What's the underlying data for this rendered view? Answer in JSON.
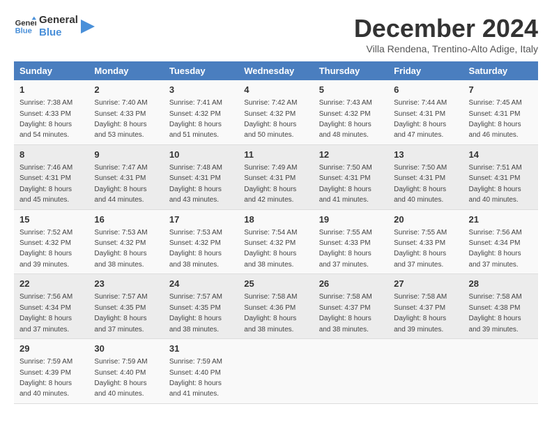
{
  "header": {
    "logo_line1": "General",
    "logo_line2": "Blue",
    "month": "December 2024",
    "location": "Villa Rendena, Trentino-Alto Adige, Italy"
  },
  "days_of_week": [
    "Sunday",
    "Monday",
    "Tuesday",
    "Wednesday",
    "Thursday",
    "Friday",
    "Saturday"
  ],
  "weeks": [
    [
      {
        "num": "1",
        "sunrise": "7:38 AM",
        "sunset": "4:33 PM",
        "daylight": "8 hours and 54 minutes."
      },
      {
        "num": "2",
        "sunrise": "7:40 AM",
        "sunset": "4:33 PM",
        "daylight": "8 hours and 53 minutes."
      },
      {
        "num": "3",
        "sunrise": "7:41 AM",
        "sunset": "4:32 PM",
        "daylight": "8 hours and 51 minutes."
      },
      {
        "num": "4",
        "sunrise": "7:42 AM",
        "sunset": "4:32 PM",
        "daylight": "8 hours and 50 minutes."
      },
      {
        "num": "5",
        "sunrise": "7:43 AM",
        "sunset": "4:32 PM",
        "daylight": "8 hours and 48 minutes."
      },
      {
        "num": "6",
        "sunrise": "7:44 AM",
        "sunset": "4:31 PM",
        "daylight": "8 hours and 47 minutes."
      },
      {
        "num": "7",
        "sunrise": "7:45 AM",
        "sunset": "4:31 PM",
        "daylight": "8 hours and 46 minutes."
      }
    ],
    [
      {
        "num": "8",
        "sunrise": "7:46 AM",
        "sunset": "4:31 PM",
        "daylight": "8 hours and 45 minutes."
      },
      {
        "num": "9",
        "sunrise": "7:47 AM",
        "sunset": "4:31 PM",
        "daylight": "8 hours and 44 minutes."
      },
      {
        "num": "10",
        "sunrise": "7:48 AM",
        "sunset": "4:31 PM",
        "daylight": "8 hours and 43 minutes."
      },
      {
        "num": "11",
        "sunrise": "7:49 AM",
        "sunset": "4:31 PM",
        "daylight": "8 hours and 42 minutes."
      },
      {
        "num": "12",
        "sunrise": "7:50 AM",
        "sunset": "4:31 PM",
        "daylight": "8 hours and 41 minutes."
      },
      {
        "num": "13",
        "sunrise": "7:50 AM",
        "sunset": "4:31 PM",
        "daylight": "8 hours and 40 minutes."
      },
      {
        "num": "14",
        "sunrise": "7:51 AM",
        "sunset": "4:31 PM",
        "daylight": "8 hours and 40 minutes."
      }
    ],
    [
      {
        "num": "15",
        "sunrise": "7:52 AM",
        "sunset": "4:32 PM",
        "daylight": "8 hours and 39 minutes."
      },
      {
        "num": "16",
        "sunrise": "7:53 AM",
        "sunset": "4:32 PM",
        "daylight": "8 hours and 38 minutes."
      },
      {
        "num": "17",
        "sunrise": "7:53 AM",
        "sunset": "4:32 PM",
        "daylight": "8 hours and 38 minutes."
      },
      {
        "num": "18",
        "sunrise": "7:54 AM",
        "sunset": "4:32 PM",
        "daylight": "8 hours and 38 minutes."
      },
      {
        "num": "19",
        "sunrise": "7:55 AM",
        "sunset": "4:33 PM",
        "daylight": "8 hours and 37 minutes."
      },
      {
        "num": "20",
        "sunrise": "7:55 AM",
        "sunset": "4:33 PM",
        "daylight": "8 hours and 37 minutes."
      },
      {
        "num": "21",
        "sunrise": "7:56 AM",
        "sunset": "4:34 PM",
        "daylight": "8 hours and 37 minutes."
      }
    ],
    [
      {
        "num": "22",
        "sunrise": "7:56 AM",
        "sunset": "4:34 PM",
        "daylight": "8 hours and 37 minutes."
      },
      {
        "num": "23",
        "sunrise": "7:57 AM",
        "sunset": "4:35 PM",
        "daylight": "8 hours and 37 minutes."
      },
      {
        "num": "24",
        "sunrise": "7:57 AM",
        "sunset": "4:35 PM",
        "daylight": "8 hours and 38 minutes."
      },
      {
        "num": "25",
        "sunrise": "7:58 AM",
        "sunset": "4:36 PM",
        "daylight": "8 hours and 38 minutes."
      },
      {
        "num": "26",
        "sunrise": "7:58 AM",
        "sunset": "4:37 PM",
        "daylight": "8 hours and 38 minutes."
      },
      {
        "num": "27",
        "sunrise": "7:58 AM",
        "sunset": "4:37 PM",
        "daylight": "8 hours and 39 minutes."
      },
      {
        "num": "28",
        "sunrise": "7:58 AM",
        "sunset": "4:38 PM",
        "daylight": "8 hours and 39 minutes."
      }
    ],
    [
      {
        "num": "29",
        "sunrise": "7:59 AM",
        "sunset": "4:39 PM",
        "daylight": "8 hours and 40 minutes."
      },
      {
        "num": "30",
        "sunrise": "7:59 AM",
        "sunset": "4:40 PM",
        "daylight": "8 hours and 40 minutes."
      },
      {
        "num": "31",
        "sunrise": "7:59 AM",
        "sunset": "4:40 PM",
        "daylight": "8 hours and 41 minutes."
      },
      null,
      null,
      null,
      null
    ]
  ]
}
